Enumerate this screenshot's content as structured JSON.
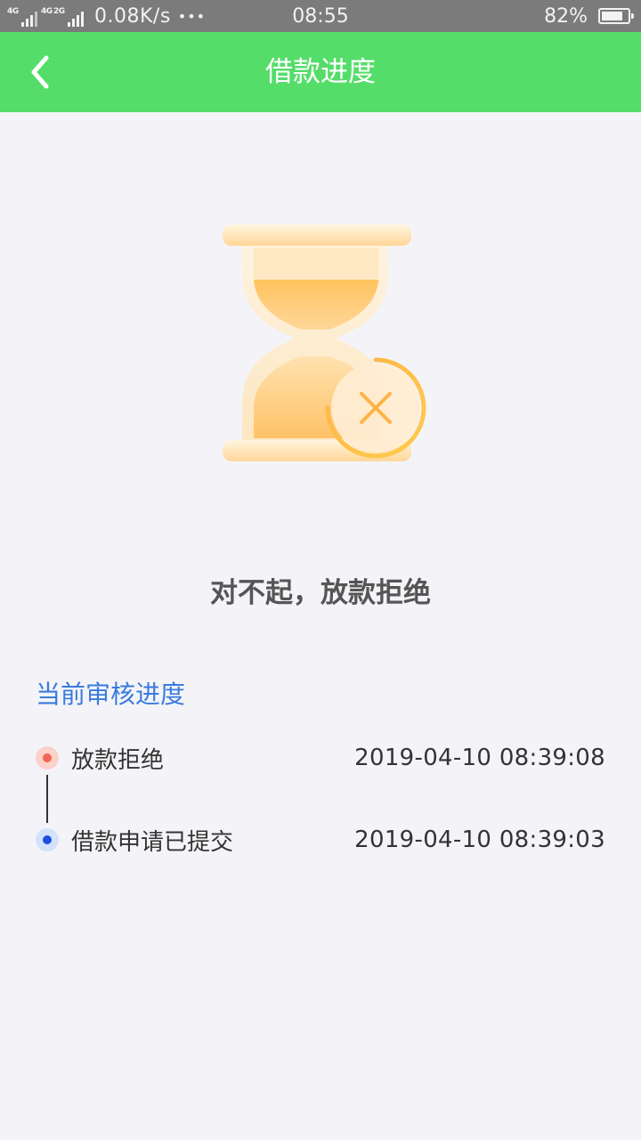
{
  "status_bar": {
    "network_1": "4G",
    "network_2": "4G",
    "network_3": "2G",
    "speed": "0.08K/s",
    "more": "•••",
    "time": "08:55",
    "battery_percent": "82%",
    "battery_level": 0.82
  },
  "nav": {
    "back_icon": "chevron-left-icon",
    "title": "借款进度"
  },
  "result": {
    "icon": "hourglass-rejected-icon",
    "message": "对不起，放款拒绝"
  },
  "progress": {
    "section_title": "当前审核进度",
    "steps": [
      {
        "label": "放款拒绝",
        "time": "2019-04-10 08:39:08",
        "status_color": "#f26552",
        "halo_color": "#fcd1c9"
      },
      {
        "label": "借款申请已提交",
        "time": "2019-04-10 08:39:03",
        "status_color": "#1f4ee0",
        "halo_color": "#d4e2fb"
      }
    ]
  },
  "colors": {
    "nav_bar": "#55dd6a",
    "status_bar": "#7b7b7b",
    "accent": "#3a7bde",
    "background": "#f4f4f8"
  }
}
